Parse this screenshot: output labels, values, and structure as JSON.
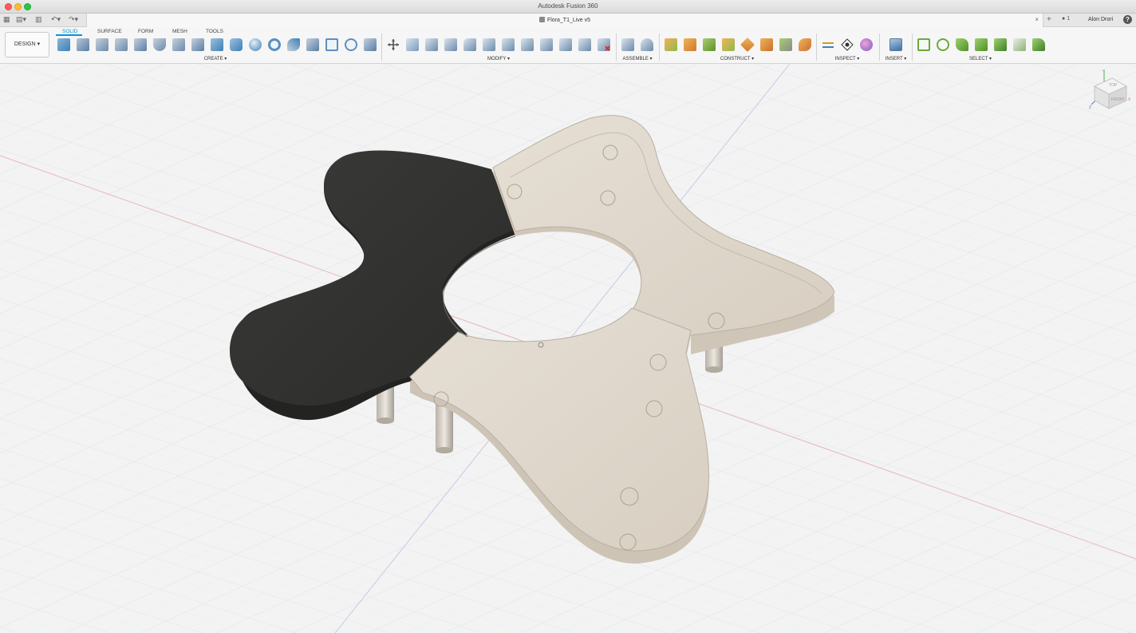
{
  "window": {
    "title": "Autodesk Fusion 360"
  },
  "tabbar": {
    "document_name": "Flora_T1_Live v5",
    "close_glyph": "×",
    "add_glyph": "+",
    "jobs_count": "1",
    "user_name": "Alon Drori",
    "help_glyph": "?"
  },
  "toolbar": {
    "workspace_label": "DESIGN ▾",
    "tabs": [
      "SOLID",
      "SURFACE",
      "FORM",
      "MESH",
      "TOOLS"
    ],
    "active_tab": "SOLID",
    "groups": {
      "create": "CREATE ▾",
      "modify": "MODIFY ▾",
      "assemble": "ASSEMBLE ▾",
      "construct": "CONSTRUCT ▾",
      "inspect": "INSPECT ▾",
      "insert": "INSERT ▾",
      "select": "SELECT ▾"
    }
  },
  "viewcube": {
    "face_top": "TOP",
    "face_front": "FRONT",
    "axis_x": "X",
    "axis_y": "Y",
    "axis_z": "Z"
  },
  "colors": {
    "accent": "#0696d7",
    "dark_part": "#2f2f2d",
    "light_part": "#ddd5c9",
    "grid": "#d9dde4"
  }
}
